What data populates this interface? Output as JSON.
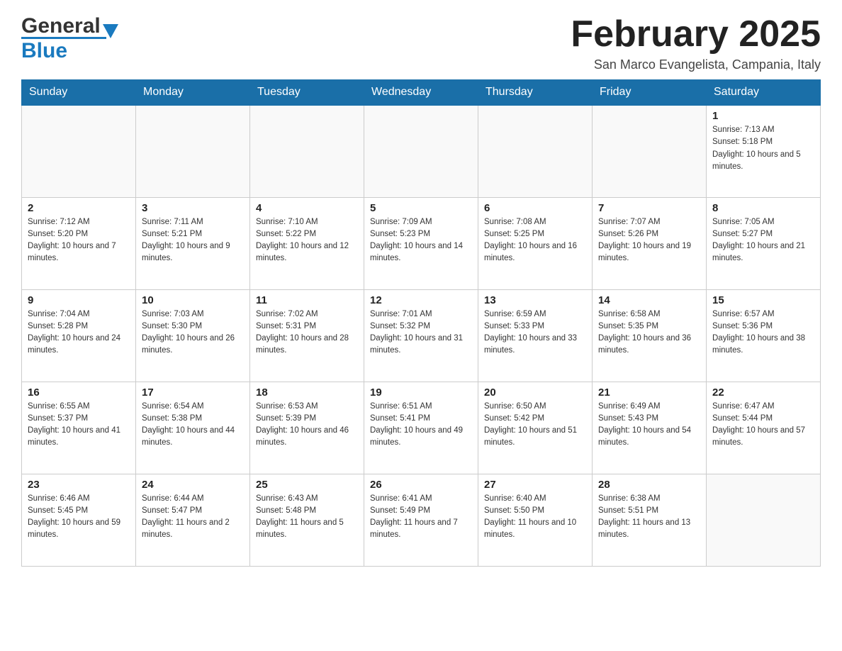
{
  "header": {
    "logo_general": "General",
    "logo_blue": "Blue",
    "month_title": "February 2025",
    "location": "San Marco Evangelista, Campania, Italy"
  },
  "days_of_week": [
    "Sunday",
    "Monday",
    "Tuesday",
    "Wednesday",
    "Thursday",
    "Friday",
    "Saturday"
  ],
  "weeks": [
    [
      {
        "day": "",
        "info": ""
      },
      {
        "day": "",
        "info": ""
      },
      {
        "day": "",
        "info": ""
      },
      {
        "day": "",
        "info": ""
      },
      {
        "day": "",
        "info": ""
      },
      {
        "day": "",
        "info": ""
      },
      {
        "day": "1",
        "info": "Sunrise: 7:13 AM\nSunset: 5:18 PM\nDaylight: 10 hours and 5 minutes."
      }
    ],
    [
      {
        "day": "2",
        "info": "Sunrise: 7:12 AM\nSunset: 5:20 PM\nDaylight: 10 hours and 7 minutes."
      },
      {
        "day": "3",
        "info": "Sunrise: 7:11 AM\nSunset: 5:21 PM\nDaylight: 10 hours and 9 minutes."
      },
      {
        "day": "4",
        "info": "Sunrise: 7:10 AM\nSunset: 5:22 PM\nDaylight: 10 hours and 12 minutes."
      },
      {
        "day": "5",
        "info": "Sunrise: 7:09 AM\nSunset: 5:23 PM\nDaylight: 10 hours and 14 minutes."
      },
      {
        "day": "6",
        "info": "Sunrise: 7:08 AM\nSunset: 5:25 PM\nDaylight: 10 hours and 16 minutes."
      },
      {
        "day": "7",
        "info": "Sunrise: 7:07 AM\nSunset: 5:26 PM\nDaylight: 10 hours and 19 minutes."
      },
      {
        "day": "8",
        "info": "Sunrise: 7:05 AM\nSunset: 5:27 PM\nDaylight: 10 hours and 21 minutes."
      }
    ],
    [
      {
        "day": "9",
        "info": "Sunrise: 7:04 AM\nSunset: 5:28 PM\nDaylight: 10 hours and 24 minutes."
      },
      {
        "day": "10",
        "info": "Sunrise: 7:03 AM\nSunset: 5:30 PM\nDaylight: 10 hours and 26 minutes."
      },
      {
        "day": "11",
        "info": "Sunrise: 7:02 AM\nSunset: 5:31 PM\nDaylight: 10 hours and 28 minutes."
      },
      {
        "day": "12",
        "info": "Sunrise: 7:01 AM\nSunset: 5:32 PM\nDaylight: 10 hours and 31 minutes."
      },
      {
        "day": "13",
        "info": "Sunrise: 6:59 AM\nSunset: 5:33 PM\nDaylight: 10 hours and 33 minutes."
      },
      {
        "day": "14",
        "info": "Sunrise: 6:58 AM\nSunset: 5:35 PM\nDaylight: 10 hours and 36 minutes."
      },
      {
        "day": "15",
        "info": "Sunrise: 6:57 AM\nSunset: 5:36 PM\nDaylight: 10 hours and 38 minutes."
      }
    ],
    [
      {
        "day": "16",
        "info": "Sunrise: 6:55 AM\nSunset: 5:37 PM\nDaylight: 10 hours and 41 minutes."
      },
      {
        "day": "17",
        "info": "Sunrise: 6:54 AM\nSunset: 5:38 PM\nDaylight: 10 hours and 44 minutes."
      },
      {
        "day": "18",
        "info": "Sunrise: 6:53 AM\nSunset: 5:39 PM\nDaylight: 10 hours and 46 minutes."
      },
      {
        "day": "19",
        "info": "Sunrise: 6:51 AM\nSunset: 5:41 PM\nDaylight: 10 hours and 49 minutes."
      },
      {
        "day": "20",
        "info": "Sunrise: 6:50 AM\nSunset: 5:42 PM\nDaylight: 10 hours and 51 minutes."
      },
      {
        "day": "21",
        "info": "Sunrise: 6:49 AM\nSunset: 5:43 PM\nDaylight: 10 hours and 54 minutes."
      },
      {
        "day": "22",
        "info": "Sunrise: 6:47 AM\nSunset: 5:44 PM\nDaylight: 10 hours and 57 minutes."
      }
    ],
    [
      {
        "day": "23",
        "info": "Sunrise: 6:46 AM\nSunset: 5:45 PM\nDaylight: 10 hours and 59 minutes."
      },
      {
        "day": "24",
        "info": "Sunrise: 6:44 AM\nSunset: 5:47 PM\nDaylight: 11 hours and 2 minutes."
      },
      {
        "day": "25",
        "info": "Sunrise: 6:43 AM\nSunset: 5:48 PM\nDaylight: 11 hours and 5 minutes."
      },
      {
        "day": "26",
        "info": "Sunrise: 6:41 AM\nSunset: 5:49 PM\nDaylight: 11 hours and 7 minutes."
      },
      {
        "day": "27",
        "info": "Sunrise: 6:40 AM\nSunset: 5:50 PM\nDaylight: 11 hours and 10 minutes."
      },
      {
        "day": "28",
        "info": "Sunrise: 6:38 AM\nSunset: 5:51 PM\nDaylight: 11 hours and 13 minutes."
      },
      {
        "day": "",
        "info": ""
      }
    ]
  ]
}
